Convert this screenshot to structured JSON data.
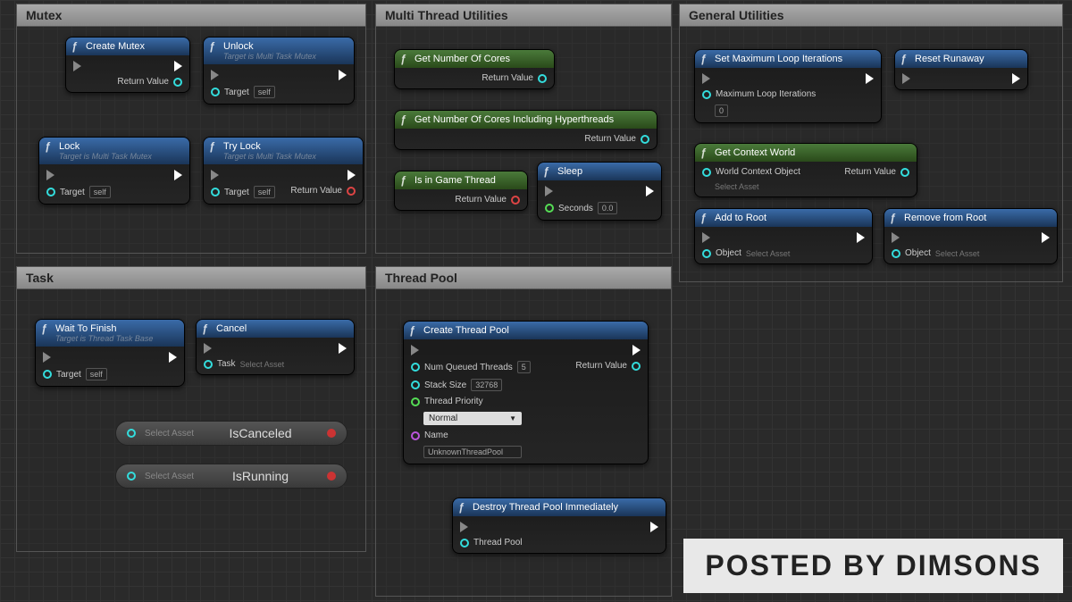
{
  "panels": {
    "mutex": {
      "title": "Mutex"
    },
    "multithread": {
      "title": "Multi Thread Utilities"
    },
    "general": {
      "title": "General Utilities"
    },
    "task": {
      "title": "Task"
    },
    "threadpool": {
      "title": "Thread Pool"
    }
  },
  "labels": {
    "return_value": "Return Value",
    "target": "Target",
    "self": "self",
    "select_asset": "Select Asset",
    "object": "Object",
    "seconds": "Seconds",
    "task_label": "Task"
  },
  "nodes": {
    "create_mutex": {
      "title": "Create Mutex"
    },
    "unlock": {
      "title": "Unlock",
      "subtitle": "Target is Multi Task Mutex"
    },
    "lock": {
      "title": "Lock",
      "subtitle": "Target is Multi Task Mutex"
    },
    "try_lock": {
      "title": "Try Lock",
      "subtitle": "Target is Multi Task Mutex"
    },
    "get_cores": {
      "title": "Get Number Of Cores"
    },
    "get_cores_ht": {
      "title": "Get Number Of Cores Including Hyperthreads"
    },
    "is_game_thread": {
      "title": "Is in Game Thread"
    },
    "sleep": {
      "title": "Sleep",
      "seconds_value": "0.0"
    },
    "set_max_loop": {
      "title": "Set Maximum Loop Iterations",
      "param_label": "Maximum Loop Iterations",
      "param_value": "0"
    },
    "reset_runaway": {
      "title": "Reset Runaway"
    },
    "get_context": {
      "title": "Get Context World",
      "param_label": "World Context Object"
    },
    "add_root": {
      "title": "Add to Root"
    },
    "remove_root": {
      "title": "Remove from Root"
    },
    "wait_finish": {
      "title": "Wait To Finish",
      "subtitle": "Target is Thread Task Base"
    },
    "cancel": {
      "title": "Cancel"
    },
    "create_pool": {
      "title": "Create Thread Pool",
      "num_threads_label": "Num Queued Threads",
      "num_threads_value": "5",
      "stack_size_label": "Stack Size",
      "stack_size_value": "32768",
      "priority_label": "Thread Priority",
      "priority_value": "Normal",
      "name_label": "Name",
      "name_value": "UnknownThreadPool"
    },
    "destroy_pool": {
      "title": "Destroy Thread Pool Immediately",
      "param_label": "Thread Pool"
    }
  },
  "status": {
    "is_canceled": "IsCanceled",
    "is_running": "IsRunning"
  },
  "watermark": "POSTED BY DIMSONS"
}
